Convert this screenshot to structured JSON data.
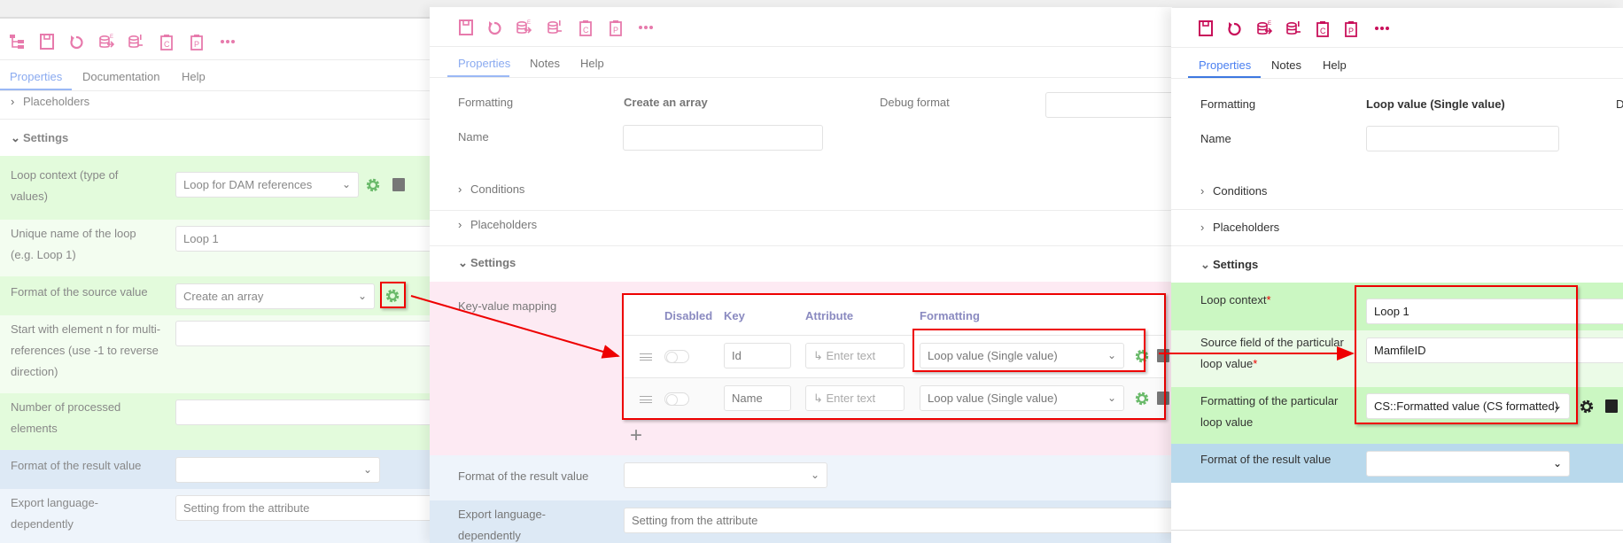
{
  "colors": {
    "accent_faded": "#e77aac",
    "accent": "#c8105a",
    "green": "#e3fbdc",
    "green_light": "#f3fdf0",
    "right_green": "#cbf7c2",
    "right_green_light": "#ebfbe7",
    "pink": "#fdeaf3",
    "blue_light": "#eef4fb",
    "blue": "#dde9f5",
    "right_blue": "#b9d9ec",
    "annotation": "#e00000"
  },
  "toolbar_icons": [
    "tree-icon",
    "save-icon",
    "undo-icon",
    "db-export-icon",
    "db-import-icon",
    "clipboard-c-icon",
    "clipboard-p-icon",
    "more-icon"
  ],
  "left": {
    "tabs": [
      "Properties",
      "Documentation",
      "Help"
    ],
    "placeholders": "Placeholders",
    "settings": "Settings",
    "fields": [
      {
        "label": "Loop context (type of values)",
        "value": "Loop for DAM references"
      },
      {
        "label": "Unique name of the loop (e.g. Loop 1)",
        "value": "Loop 1"
      },
      {
        "label": "Format of the source value",
        "value": "Create an array"
      },
      {
        "label": "Start with element n for multi-references (use -1 to reverse direction)",
        "value": ""
      },
      {
        "label": "Number of processed elements",
        "value": ""
      },
      {
        "label": "Format of the result value",
        "value": ""
      },
      {
        "label": "Export language-dependently",
        "value": "Setting from the attribute"
      }
    ]
  },
  "middle": {
    "tabs": [
      "Properties",
      "Notes",
      "Help"
    ],
    "formatting_label": "Formatting",
    "formatting_value": "Create an array",
    "debug_label": "Debug format",
    "name_label": "Name",
    "name_value": "",
    "conditions": "Conditions",
    "placeholders": "Placeholders",
    "settings": "Settings",
    "kv_label": "Key-value mapping",
    "kv_headers": [
      "Disabled",
      "Key",
      "Attribute",
      "Formatting"
    ],
    "kv_rows": [
      {
        "key": "Id",
        "attribute_placeholder": "Enter text",
        "formatting": "Loop value (Single value)"
      },
      {
        "key": "Name",
        "attribute_placeholder": "Enter text",
        "formatting": "Loop value (Single value)"
      }
    ],
    "add": "+",
    "result_label": "Format of the result value",
    "result_value": "",
    "export_label": "Export language-dependently",
    "export_value": "Setting from the attribute"
  },
  "right": {
    "tabs": [
      "Properties",
      "Notes",
      "Help"
    ],
    "formatting_label": "Formatting",
    "formatting_value": "Loop value (Single value)",
    "debug_cut": "D",
    "name_label": "Name",
    "name_value": "",
    "conditions": "Conditions",
    "placeholders": "Placeholders",
    "settings": "Settings",
    "req": "*",
    "fields": [
      {
        "label": "Loop context",
        "value": "Loop 1"
      },
      {
        "label": "Source field of the particular loop value",
        "value": "MamfileID"
      },
      {
        "label": "Formatting of the particular loop value",
        "value": "CS::Formatted value (CS formatted)"
      },
      {
        "label": "Format of the result value",
        "value": ""
      }
    ]
  }
}
